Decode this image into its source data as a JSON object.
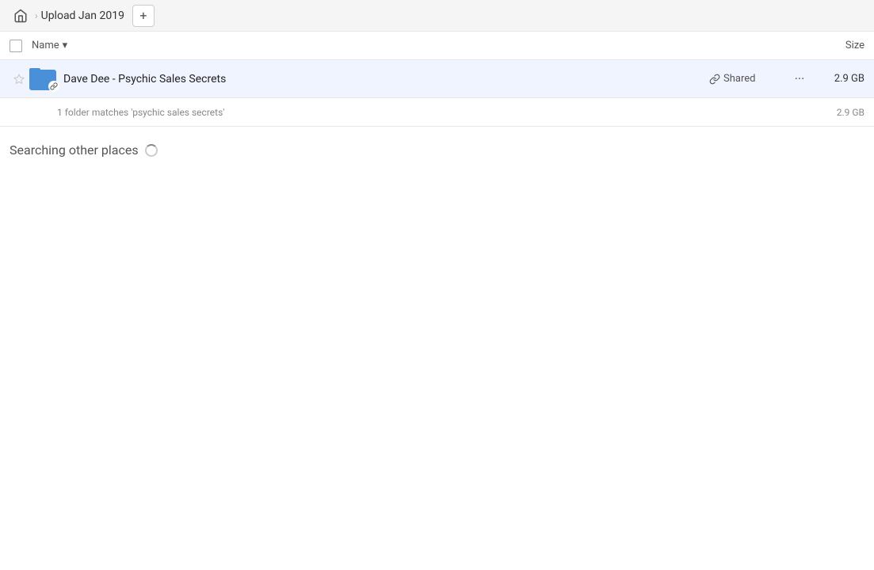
{
  "topbar": {
    "home_label": "Home",
    "breadcrumb_title": "Upload Jan 2019",
    "add_button_label": "+"
  },
  "columns": {
    "name_label": "Name",
    "size_label": "Size",
    "sort_icon": "▾"
  },
  "file_row": {
    "name": "Dave Dee - Psychic Sales Secrets",
    "shared_label": "Shared",
    "size": "2.9 GB",
    "more_icon": "···"
  },
  "match_row": {
    "text": "1 folder matches 'psychic sales secrets'",
    "size": "2.9 GB"
  },
  "searching": {
    "text": "Searching other places"
  }
}
